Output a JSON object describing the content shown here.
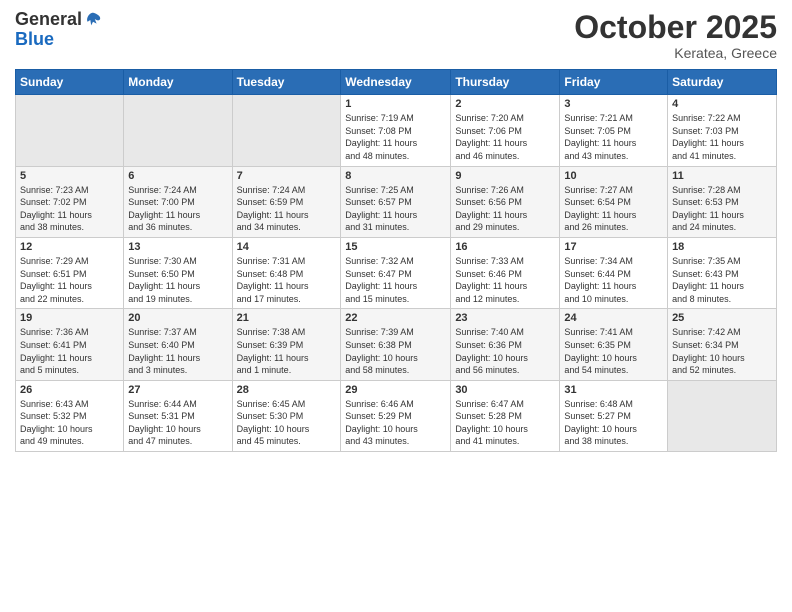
{
  "header": {
    "logo_general": "General",
    "logo_blue": "Blue",
    "month": "October 2025",
    "location": "Keratea, Greece"
  },
  "weekdays": [
    "Sunday",
    "Monday",
    "Tuesday",
    "Wednesday",
    "Thursday",
    "Friday",
    "Saturday"
  ],
  "weeks": [
    [
      {
        "day": "",
        "info": ""
      },
      {
        "day": "",
        "info": ""
      },
      {
        "day": "",
        "info": ""
      },
      {
        "day": "1",
        "info": "Sunrise: 7:19 AM\nSunset: 7:08 PM\nDaylight: 11 hours\nand 48 minutes."
      },
      {
        "day": "2",
        "info": "Sunrise: 7:20 AM\nSunset: 7:06 PM\nDaylight: 11 hours\nand 46 minutes."
      },
      {
        "day": "3",
        "info": "Sunrise: 7:21 AM\nSunset: 7:05 PM\nDaylight: 11 hours\nand 43 minutes."
      },
      {
        "day": "4",
        "info": "Sunrise: 7:22 AM\nSunset: 7:03 PM\nDaylight: 11 hours\nand 41 minutes."
      }
    ],
    [
      {
        "day": "5",
        "info": "Sunrise: 7:23 AM\nSunset: 7:02 PM\nDaylight: 11 hours\nand 38 minutes."
      },
      {
        "day": "6",
        "info": "Sunrise: 7:24 AM\nSunset: 7:00 PM\nDaylight: 11 hours\nand 36 minutes."
      },
      {
        "day": "7",
        "info": "Sunrise: 7:24 AM\nSunset: 6:59 PM\nDaylight: 11 hours\nand 34 minutes."
      },
      {
        "day": "8",
        "info": "Sunrise: 7:25 AM\nSunset: 6:57 PM\nDaylight: 11 hours\nand 31 minutes."
      },
      {
        "day": "9",
        "info": "Sunrise: 7:26 AM\nSunset: 6:56 PM\nDaylight: 11 hours\nand 29 minutes."
      },
      {
        "day": "10",
        "info": "Sunrise: 7:27 AM\nSunset: 6:54 PM\nDaylight: 11 hours\nand 26 minutes."
      },
      {
        "day": "11",
        "info": "Sunrise: 7:28 AM\nSunset: 6:53 PM\nDaylight: 11 hours\nand 24 minutes."
      }
    ],
    [
      {
        "day": "12",
        "info": "Sunrise: 7:29 AM\nSunset: 6:51 PM\nDaylight: 11 hours\nand 22 minutes."
      },
      {
        "day": "13",
        "info": "Sunrise: 7:30 AM\nSunset: 6:50 PM\nDaylight: 11 hours\nand 19 minutes."
      },
      {
        "day": "14",
        "info": "Sunrise: 7:31 AM\nSunset: 6:48 PM\nDaylight: 11 hours\nand 17 minutes."
      },
      {
        "day": "15",
        "info": "Sunrise: 7:32 AM\nSunset: 6:47 PM\nDaylight: 11 hours\nand 15 minutes."
      },
      {
        "day": "16",
        "info": "Sunrise: 7:33 AM\nSunset: 6:46 PM\nDaylight: 11 hours\nand 12 minutes."
      },
      {
        "day": "17",
        "info": "Sunrise: 7:34 AM\nSunset: 6:44 PM\nDaylight: 11 hours\nand 10 minutes."
      },
      {
        "day": "18",
        "info": "Sunrise: 7:35 AM\nSunset: 6:43 PM\nDaylight: 11 hours\nand 8 minutes."
      }
    ],
    [
      {
        "day": "19",
        "info": "Sunrise: 7:36 AM\nSunset: 6:41 PM\nDaylight: 11 hours\nand 5 minutes."
      },
      {
        "day": "20",
        "info": "Sunrise: 7:37 AM\nSunset: 6:40 PM\nDaylight: 11 hours\nand 3 minutes."
      },
      {
        "day": "21",
        "info": "Sunrise: 7:38 AM\nSunset: 6:39 PM\nDaylight: 11 hours\nand 1 minute."
      },
      {
        "day": "22",
        "info": "Sunrise: 7:39 AM\nSunset: 6:38 PM\nDaylight: 10 hours\nand 58 minutes."
      },
      {
        "day": "23",
        "info": "Sunrise: 7:40 AM\nSunset: 6:36 PM\nDaylight: 10 hours\nand 56 minutes."
      },
      {
        "day": "24",
        "info": "Sunrise: 7:41 AM\nSunset: 6:35 PM\nDaylight: 10 hours\nand 54 minutes."
      },
      {
        "day": "25",
        "info": "Sunrise: 7:42 AM\nSunset: 6:34 PM\nDaylight: 10 hours\nand 52 minutes."
      }
    ],
    [
      {
        "day": "26",
        "info": "Sunrise: 6:43 AM\nSunset: 5:32 PM\nDaylight: 10 hours\nand 49 minutes."
      },
      {
        "day": "27",
        "info": "Sunrise: 6:44 AM\nSunset: 5:31 PM\nDaylight: 10 hours\nand 47 minutes."
      },
      {
        "day": "28",
        "info": "Sunrise: 6:45 AM\nSunset: 5:30 PM\nDaylight: 10 hours\nand 45 minutes."
      },
      {
        "day": "29",
        "info": "Sunrise: 6:46 AM\nSunset: 5:29 PM\nDaylight: 10 hours\nand 43 minutes."
      },
      {
        "day": "30",
        "info": "Sunrise: 6:47 AM\nSunset: 5:28 PM\nDaylight: 10 hours\nand 41 minutes."
      },
      {
        "day": "31",
        "info": "Sunrise: 6:48 AM\nSunset: 5:27 PM\nDaylight: 10 hours\nand 38 minutes."
      },
      {
        "day": "",
        "info": ""
      }
    ]
  ]
}
